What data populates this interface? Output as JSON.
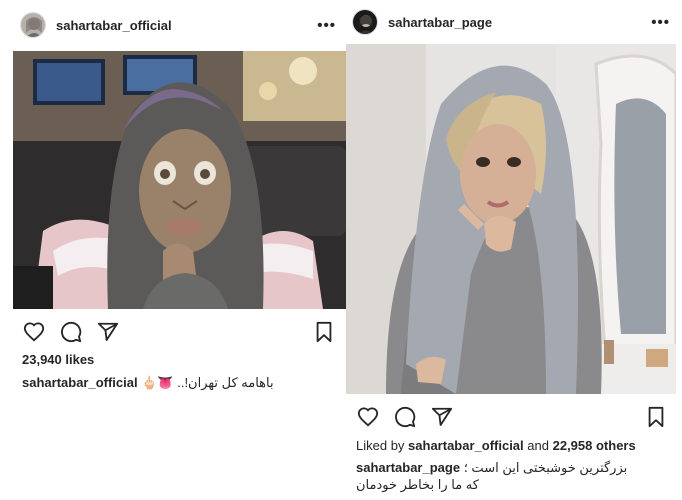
{
  "posts": [
    {
      "username": "sahartabar_official",
      "more_icon": "more-dots-icon",
      "likes_text": "23,940 likes",
      "caption_user": "sahartabar_official",
      "caption_text": "باهامه کل تهران!.. 👅🖕🏻",
      "icons": [
        "heart-icon",
        "comment-icon",
        "share-icon",
        "bookmark-icon"
      ]
    },
    {
      "username": "sahartabar_page",
      "more_icon": "more-dots-icon",
      "liked_by_prefix": "Liked by",
      "liked_by_user": "sahartabar_official",
      "liked_by_and": "and",
      "liked_by_others": "22,958 others",
      "caption_user": "sahartabar_page",
      "caption_line1": "بزرگترین خوشبختی این است ؛",
      "caption_line2": "که ما را بخاطر خودمان",
      "icons": [
        "heart-icon",
        "comment-icon",
        "share-icon",
        "bookmark-icon"
      ]
    }
  ],
  "more_glyph": "•••"
}
